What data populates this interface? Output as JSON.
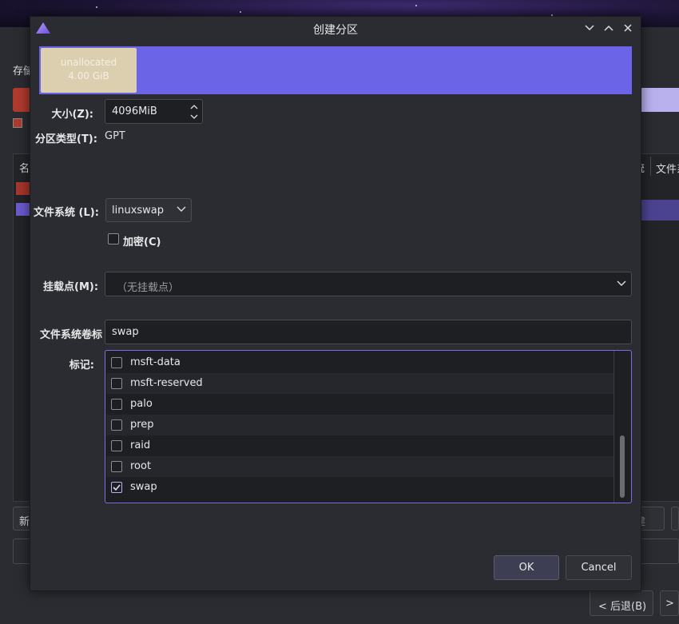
{
  "background": {
    "storage_label": "存储",
    "table_header_name": "名",
    "table_header_fs_partial": "统",
    "table_header_fs": "文件系统",
    "new_button_partial": "新",
    "right_button_partial": "建",
    "back_button": "后退(B)",
    "back_arrow": "<",
    "next_arrow": ">"
  },
  "dialog": {
    "title": "创建分区",
    "partition_bar": {
      "segment_name": "unallocated",
      "segment_size": "4.00 GiB",
      "free_color": "#6b64e6",
      "segment_color": "#dccfb0"
    },
    "size": {
      "label": "大小(Z):",
      "value": "4096MiB"
    },
    "partition_type": {
      "label": "分区类型(T):",
      "value": "GPT"
    },
    "filesystem": {
      "label": "文件系统 (L):",
      "value": "linuxswap"
    },
    "encrypt": {
      "label": "加密(C)",
      "checked": false
    },
    "mount_point": {
      "label": "挂载点(M):",
      "value": "（无挂载点）"
    },
    "fs_label": {
      "label": "文件系统卷标",
      "value": "swap"
    },
    "flags": {
      "label": "标记:",
      "items": [
        {
          "name": "msft-data",
          "checked": false
        },
        {
          "name": "msft-reserved",
          "checked": false
        },
        {
          "name": "palo",
          "checked": false
        },
        {
          "name": "prep",
          "checked": false
        },
        {
          "name": "raid",
          "checked": false
        },
        {
          "name": "root",
          "checked": false
        },
        {
          "name": "swap",
          "checked": true
        }
      ]
    },
    "ok_button": "OK",
    "cancel_button": "Cancel"
  }
}
